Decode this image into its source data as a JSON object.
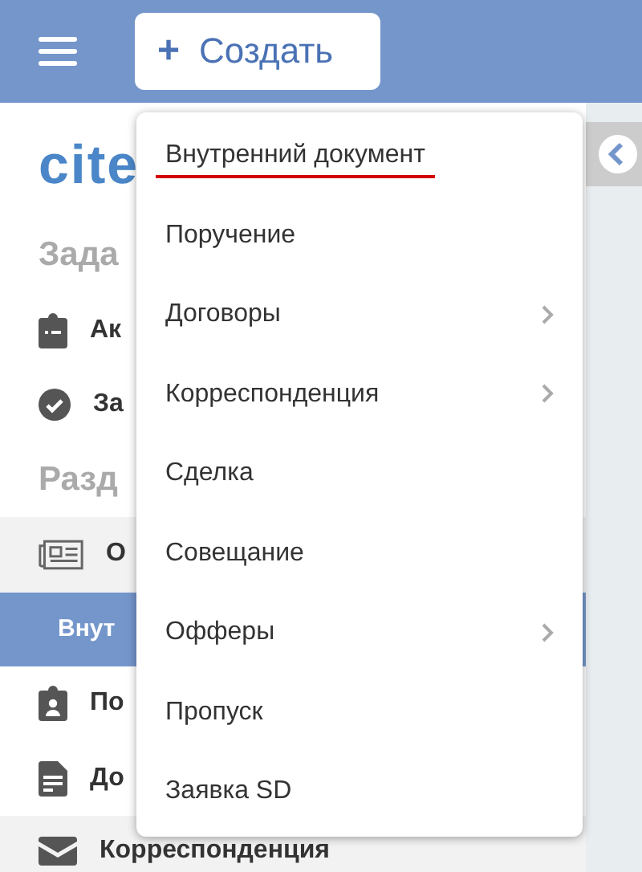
{
  "header": {
    "create_button": {
      "icon": "+",
      "label": "Создать"
    }
  },
  "sidebar": {
    "logo": "cite",
    "rows": [
      {
        "kind": "title",
        "label": "Зада"
      },
      {
        "kind": "clipboard",
        "label": "Ак",
        "selected": false
      },
      {
        "kind": "check",
        "label": "За",
        "selected": false
      },
      {
        "kind": "title",
        "label": "Разд"
      },
      {
        "kind": "news",
        "label": "О",
        "selected": false
      },
      {
        "kind": "plain",
        "label": "Внут",
        "selected": true
      },
      {
        "kind": "person",
        "label": "По",
        "selected": false
      },
      {
        "kind": "doc",
        "label": "До",
        "selected": false
      },
      {
        "kind": "mail",
        "label": "Корреспонденция",
        "selected": false
      }
    ]
  },
  "dropdown": {
    "items": [
      {
        "label": "Внутренний документ",
        "submenu": false,
        "highlighted": true
      },
      {
        "label": "Поручение",
        "submenu": false,
        "highlighted": false
      },
      {
        "label": "Договоры",
        "submenu": true,
        "highlighted": false
      },
      {
        "label": "Корреспонденция",
        "submenu": true,
        "highlighted": false
      },
      {
        "label": "Сделка",
        "submenu": false,
        "highlighted": false
      },
      {
        "label": "Совещание",
        "submenu": false,
        "highlighted": false
      },
      {
        "label": "Офферы",
        "submenu": true,
        "highlighted": false
      },
      {
        "label": "Пропуск",
        "submenu": false,
        "highlighted": false
      },
      {
        "label": "Заявка SD",
        "submenu": false,
        "highlighted": false
      }
    ]
  }
}
